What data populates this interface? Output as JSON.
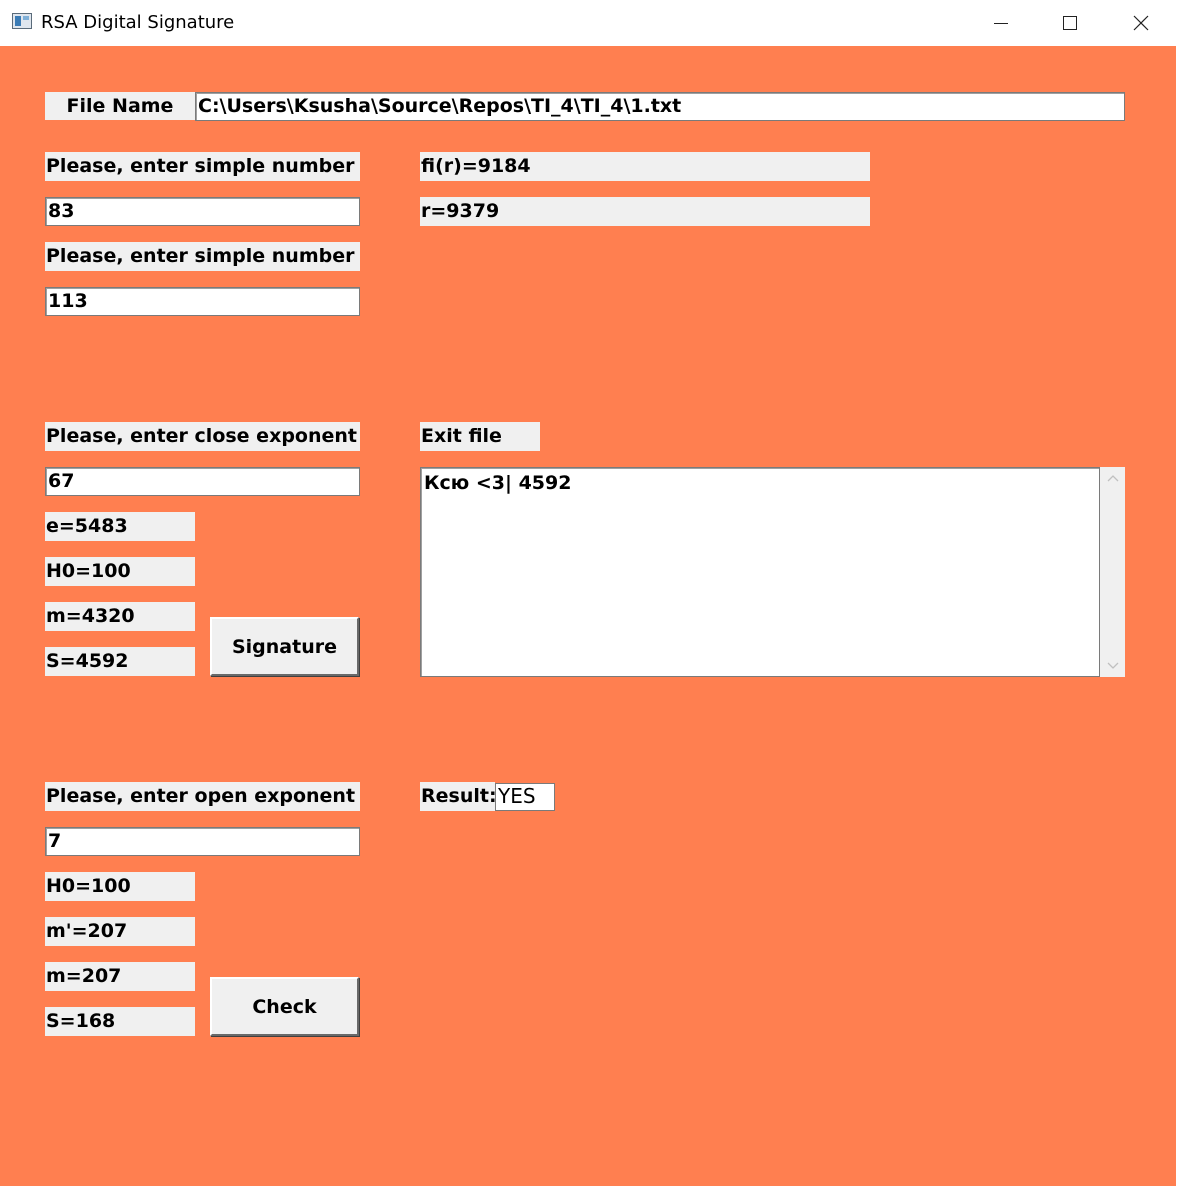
{
  "window": {
    "title": "RSA Digital Signature",
    "icons": {
      "app": "app-window-icon",
      "minimize": "minimize-icon",
      "maximize": "maximize-icon",
      "close": "close-icon"
    }
  },
  "colors": {
    "client_background": "#ff7f50",
    "label_background": "#f0f0f0"
  },
  "file": {
    "label": "File Name",
    "path": "C:\\Users\\Ksusha\\Source\\Repos\\TI_4\\TI_4\\1.txt"
  },
  "keys": {
    "p_label": "Please, enter  simple number p",
    "p_value": "83",
    "q_label": "Please, enter  simple number q",
    "q_value": "113",
    "fi_r": "fi(r)=9184",
    "r": "r=9379"
  },
  "sign": {
    "d_label": "Please, enter close exponent d",
    "d_value": "67",
    "e": "e=5483",
    "h0": "H0=100",
    "m": "m=4320",
    "s": "S=4592",
    "button_label": "Signature",
    "exit_file_label": "Exit file",
    "exit_file_content": "Ксю <3| 4592"
  },
  "check": {
    "e_label": "Please, enter open exponent e",
    "e_value": "7",
    "h0": "H0=100",
    "m_prime": "m'=207",
    "m": "m=207",
    "s": "S=168",
    "button_label": "Check",
    "result_label": "Result:",
    "result_value": "YES"
  }
}
